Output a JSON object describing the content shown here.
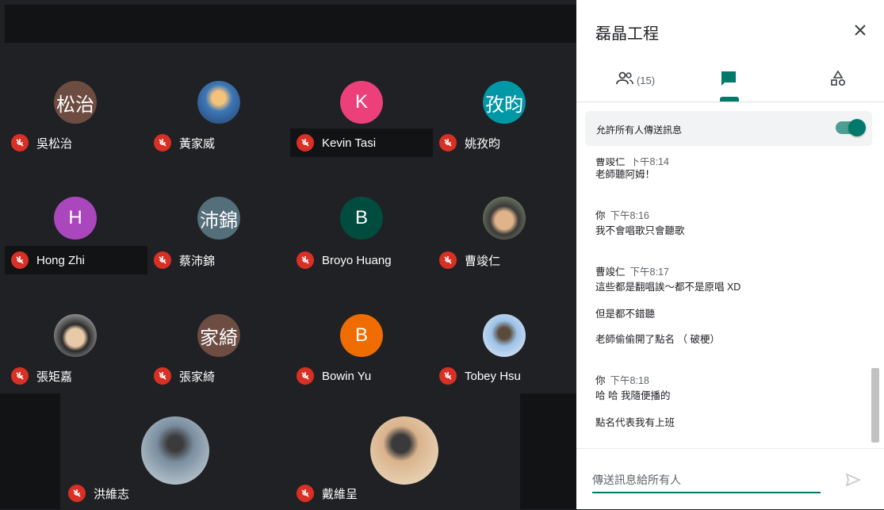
{
  "participants_grid": {
    "tiles": [
      {
        "name": "吳松治",
        "avatar_text": "松治",
        "color": "#6d4c41"
      },
      {
        "name": "黃家威",
        "avatar_text": "",
        "color": "#3a6ea5"
      },
      {
        "name": "Kevin Tasi",
        "avatar_text": "K",
        "color": "#ec407a"
      },
      {
        "name": "姚孜昀",
        "avatar_text": "孜昀",
        "color": "#0097a7"
      },
      {
        "name": "Hong Zhi",
        "avatar_text": "H",
        "color": "#ab47bc"
      },
      {
        "name": "蔡沛錦",
        "avatar_text": "沛錦",
        "color": "#546e7a"
      },
      {
        "name": "Broyo Huang",
        "avatar_text": "B",
        "color": "#004d40"
      },
      {
        "name": "曹竣仁",
        "avatar_text": "",
        "color": "#8d7b6a"
      },
      {
        "name": "張矩嘉",
        "avatar_text": "",
        "color": "#9e9e9e"
      },
      {
        "name": "張家綺",
        "avatar_text": "家綺",
        "color": "#6d4c41"
      },
      {
        "name": "Bowin Yu",
        "avatar_text": "B",
        "color": "#ef6c00"
      },
      {
        "name": "Tobey Hsu",
        "avatar_text": "",
        "color": "#b0bec5"
      }
    ],
    "bottom": [
      {
        "name": "洪維志",
        "color": "#6b7f92"
      },
      {
        "name": "戴維呈",
        "color": "#c7a27a"
      }
    ]
  },
  "panel": {
    "title": "磊晶工程",
    "people_count": "(15)",
    "allow_all_label": "允許所有人傳送訊息",
    "messages": [
      {
        "sender": "曹竣仁",
        "time": "下午8:14",
        "lines": [
          "老師聽阿姆！"
        ]
      },
      {
        "sender": "你",
        "time": "下午8:16",
        "lines": [
          "我不會唱歌只會聽歌"
        ]
      },
      {
        "sender": "曹竣仁",
        "time": "下午8:17",
        "lines": [
          "這些都是翻唱誒～都不是原唱 XD",
          "但是都不錯聽",
          "老師偷偷開了點名 （ 破梗）"
        ]
      },
      {
        "sender": "你",
        "time": "下午8:18",
        "lines": [
          "哈 哈 我隨便播的",
          "點名代表我有上班"
        ]
      }
    ],
    "input_placeholder": "傳送訊息給所有人"
  },
  "colors": {
    "accent": "#00796b",
    "mute": "#d93025"
  }
}
